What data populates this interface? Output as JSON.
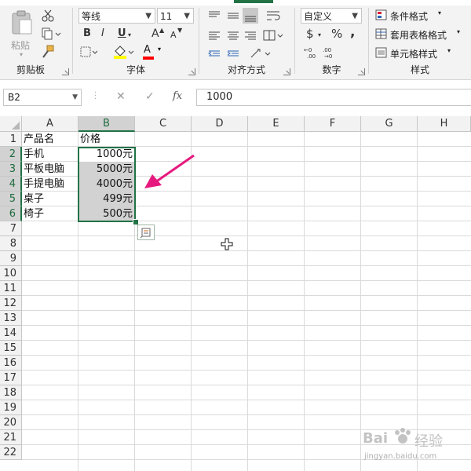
{
  "ribbon": {
    "clipboard": {
      "label": "剪贴板",
      "paste_label": "粘贴"
    },
    "font": {
      "label": "字体",
      "font_name": "等线",
      "font_size": "11",
      "bold": "B",
      "italic": "I",
      "underline": "U",
      "grow": "A",
      "shrink": "A",
      "color_letter": "A"
    },
    "alignment": {
      "label": "对齐方式"
    },
    "number": {
      "label": "数字",
      "format": "自定义",
      "currency": "$",
      "percent": "%",
      "comma": ","
    },
    "styles": {
      "label": "样式",
      "conditional": "条件格式",
      "table": "套用表格格式",
      "cell": "单元格样式"
    }
  },
  "formula_bar": {
    "name_box": "B2",
    "fx": "fx",
    "value": "1000"
  },
  "sheet": {
    "columns": [
      "A",
      "B",
      "C",
      "D",
      "E",
      "F",
      "G",
      "H"
    ],
    "rows": [
      "1",
      "2",
      "3",
      "4",
      "5",
      "6",
      "7",
      "8",
      "9",
      "10",
      "11",
      "12",
      "13",
      "14",
      "15",
      "16",
      "17",
      "18",
      "19",
      "20",
      "21",
      "22"
    ],
    "cells": {
      "A1": "产品名",
      "B1": "价格",
      "A2": "手机",
      "B2": "1000元",
      "A3": "平板电脑",
      "B3": "5000元",
      "A4": "手提电脑",
      "B4": "4000元",
      "A5": "桌子",
      "B5": "499元",
      "A6": "椅子",
      "B6": "500元"
    }
  },
  "watermark": {
    "line1": "Bai",
    "line2": "经验",
    "url": "jingyan.baidu.com"
  },
  "colors": {
    "accent": "#217346",
    "arrow": "#e6197e"
  }
}
